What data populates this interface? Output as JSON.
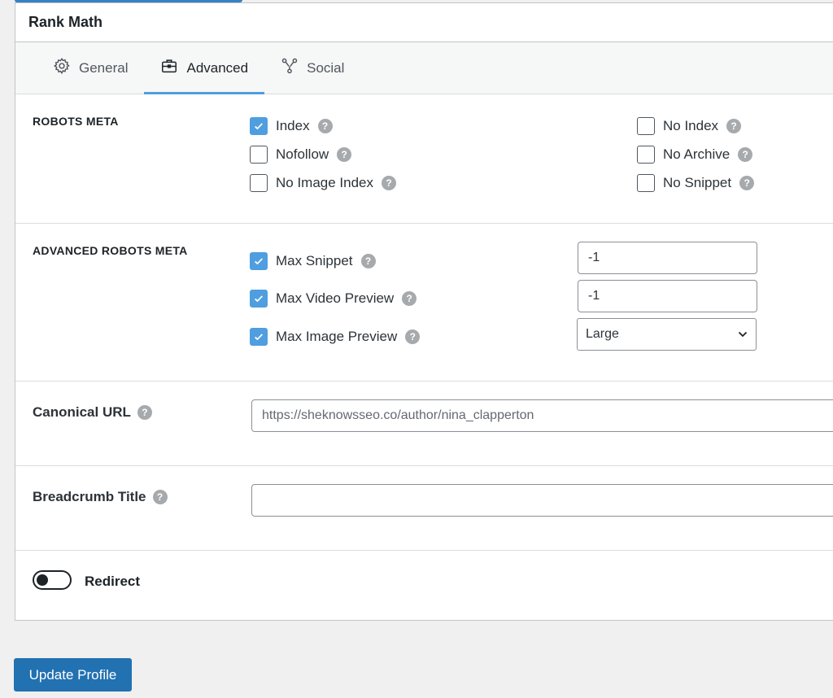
{
  "panel": {
    "title": "Rank Math"
  },
  "tabs": [
    {
      "label": "General",
      "icon": "gear-icon",
      "active": false
    },
    {
      "label": "Advanced",
      "icon": "toolbox-icon",
      "active": true
    },
    {
      "label": "Social",
      "icon": "share-icon",
      "active": false
    }
  ],
  "robots_meta": {
    "label": "ROBOTS META",
    "options": [
      {
        "label": "Index",
        "checked": true
      },
      {
        "label": "Nofollow",
        "checked": false
      },
      {
        "label": "No Image Index",
        "checked": false
      },
      {
        "label": "No Index",
        "checked": false
      },
      {
        "label": "No Archive",
        "checked": false
      },
      {
        "label": "No Snippet",
        "checked": false
      }
    ]
  },
  "advanced_robots_meta": {
    "label": "ADVANCED ROBOTS META",
    "max_snippet": {
      "label": "Max Snippet",
      "checked": true,
      "value": "-1"
    },
    "max_video_preview": {
      "label": "Max Video Preview",
      "checked": true,
      "value": "-1"
    },
    "max_image_preview": {
      "label": "Max Image Preview",
      "checked": true,
      "selected": "Large"
    }
  },
  "canonical": {
    "label": "Canonical URL",
    "placeholder": "https://sheknowsseo.co/author/nina_clapperton"
  },
  "breadcrumb": {
    "label": "Breadcrumb Title",
    "value": ""
  },
  "redirect": {
    "label": "Redirect",
    "enabled": false
  },
  "footer": {
    "update_label": "Update Profile"
  },
  "colors": {
    "accent": "#4f9ee0",
    "button": "#2271b1"
  }
}
